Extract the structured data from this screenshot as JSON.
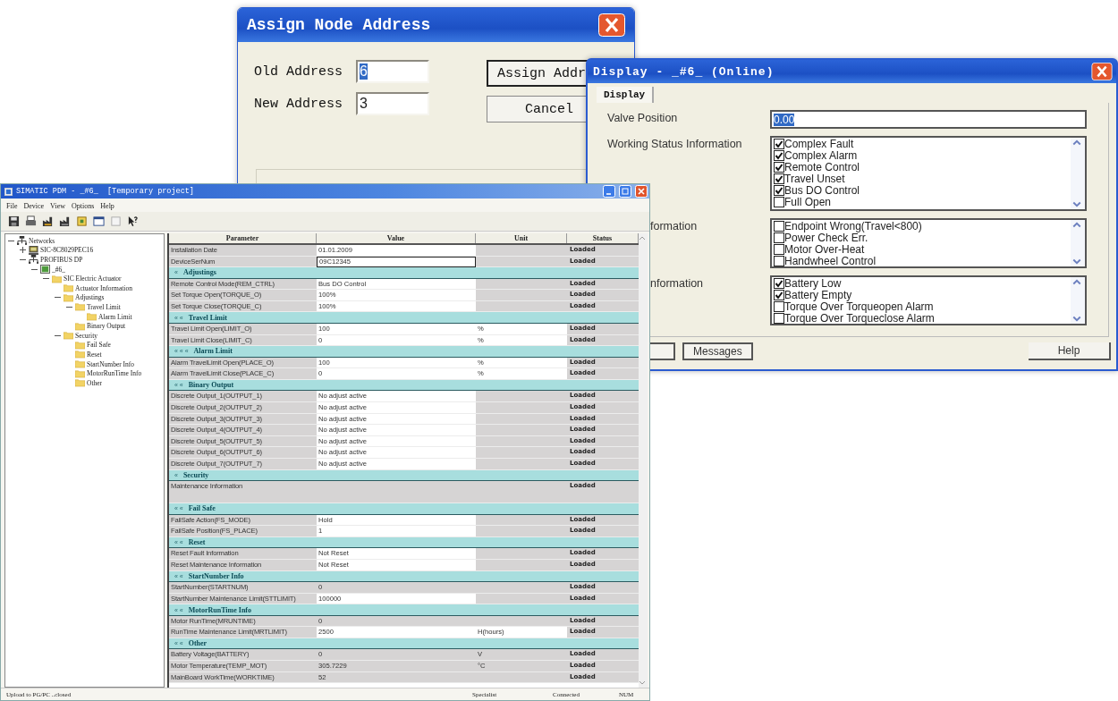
{
  "assign_dialog": {
    "title": "Assign Node Address",
    "fields": [
      {
        "label": "Old Address",
        "value": "6",
        "text_selected": true
      },
      {
        "label": "New Address",
        "value": "3",
        "text_selected": false
      }
    ],
    "buttons": [
      "Assign Addr",
      "Cancel"
    ]
  },
  "display_dialog": {
    "title": "Display - _#6_ (Online)",
    "tabs": [
      {
        "label": "Display",
        "selected": true
      }
    ],
    "valve_position": {
      "label": "Valve Position",
      "value": "0.00",
      "text_selected": true
    },
    "groups": [
      {
        "label": "Working Status Information",
        "items": [
          {
            "label": "Complex Fault",
            "checked": true
          },
          {
            "label": "Complex Alarm",
            "checked": true
          },
          {
            "label": "Remote Control",
            "checked": true
          },
          {
            "label": "Travel Unset",
            "checked": true
          },
          {
            "label": "Bus DO Control",
            "checked": true
          },
          {
            "label": "Full Open",
            "checked": false
          }
        ]
      },
      {
        "label": "formation",
        "items": [
          {
            "label": "Endpoint Wrong(Travel<800)",
            "checked": false
          },
          {
            "label": "Power Check Err.",
            "checked": false
          },
          {
            "label": "Motor Over-Heat",
            "checked": false
          },
          {
            "label": "Handwheel Control",
            "checked": false
          }
        ]
      },
      {
        "label": "nformation",
        "items": [
          {
            "label": "Battery Low",
            "checked": true
          },
          {
            "label": "Battery Empty",
            "checked": true
          },
          {
            "label": "Torque Over Torqueopen Alarm",
            "checked": false
          },
          {
            "label": "Torque Over Torqueclose Alarm",
            "checked": false
          }
        ]
      }
    ],
    "buttons": [
      "Messages",
      "Help"
    ]
  },
  "main_window": {
    "title": "SIMATIC PDM - _#6_  [Temporary project]",
    "menu": [
      "File",
      "Device",
      "View",
      "Options",
      "Help"
    ],
    "tree": [
      {
        "label": "Networks",
        "kind": "network",
        "expanded": true,
        "children": [
          {
            "label": "SIC-8C8029PEC16",
            "kind": "computer",
            "expanded": false
          },
          {
            "label": "PROFIBUS DP",
            "kind": "network",
            "expanded": true,
            "children": [
              {
                "label": "_#6_",
                "kind": "device",
                "expanded": true,
                "children": [
                  {
                    "label": "SIC Electric Actuator",
                    "kind": "folder",
                    "expanded": true,
                    "children": [
                      {
                        "label": "Actuator Information",
                        "kind": "folder"
                      },
                      {
                        "label": "Adjustings",
                        "kind": "folder",
                        "expanded": true,
                        "children": [
                          {
                            "label": "Travel Limit",
                            "kind": "folder",
                            "expanded": true,
                            "children": [
                              {
                                "label": "Alarm Limit",
                                "kind": "folder"
                              }
                            ]
                          },
                          {
                            "label": "Binary Output",
                            "kind": "folder"
                          }
                        ]
                      },
                      {
                        "label": "Security",
                        "kind": "folder",
                        "expanded": true,
                        "children": [
                          {
                            "label": "Fail Safe",
                            "kind": "folder"
                          },
                          {
                            "label": "Reset",
                            "kind": "folder"
                          },
                          {
                            "label": "StartNumber Info",
                            "kind": "folder"
                          },
                          {
                            "label": "MotorRunTime Info",
                            "kind": "folder"
                          },
                          {
                            "label": "Other",
                            "kind": "folder"
                          }
                        ]
                      }
                    ]
                  }
                ]
              }
            ]
          }
        ]
      }
    ],
    "table": {
      "columns": [
        "Parameter",
        "Value",
        "Unit",
        "Status"
      ],
      "rows": [
        {
          "kind": "param",
          "parameter": "Installation Date",
          "value": "01.01.2009",
          "status": "Loaded",
          "editable": true,
          "focused": false
        },
        {
          "kind": "param",
          "parameter": "DeviceSerNum",
          "value": "09C12345",
          "status": "Loaded",
          "editable": true,
          "focused": true
        },
        {
          "kind": "section",
          "marks": "«",
          "label": "Adjustings"
        },
        {
          "kind": "param",
          "parameter": "Remote Control Mode(REM_CTRL)",
          "value": "Bus DO Control",
          "status": "Loaded",
          "editable": true,
          "focused": false
        },
        {
          "kind": "param",
          "parameter": "Set Torque Open(TORQUE_O)",
          "value": "100%",
          "status": "Loaded",
          "editable": true,
          "focused": false
        },
        {
          "kind": "param",
          "parameter": "Set Torque Close(TORQUE_C)",
          "value": "100%",
          "status": "Loaded",
          "editable": true,
          "focused": false
        },
        {
          "kind": "section",
          "marks": "« «",
          "label": "Travel Limit"
        },
        {
          "kind": "param",
          "parameter": "Travel Limit Open(LIMIT_O)",
          "value": "100",
          "unit": "%",
          "status": "Loaded",
          "editable": true,
          "focused": false
        },
        {
          "kind": "param",
          "parameter": "Travel Limit Close(LIMIT_C)",
          "value": "0",
          "unit": "%",
          "status": "Loaded",
          "editable": true,
          "focused": false
        },
        {
          "kind": "section",
          "marks": "« « «",
          "label": "Alarm Limit"
        },
        {
          "kind": "param",
          "parameter": "Alarm TravelLimit Open(PLACE_O)",
          "value": "100",
          "unit": "%",
          "status": "Loaded",
          "editable": true,
          "focused": false
        },
        {
          "kind": "param",
          "parameter": "Alarm TravelLimit Close(PLACE_C)",
          "value": "0",
          "unit": "%",
          "status": "Loaded",
          "editable": true,
          "focused": false
        },
        {
          "kind": "section",
          "marks": "« «",
          "label": "Binary Output"
        },
        {
          "kind": "param",
          "parameter": "Discrete Output_1(OUTPUT_1)",
          "value": "No adjust active",
          "status": "Loaded",
          "editable": true,
          "focused": false
        },
        {
          "kind": "param",
          "parameter": "Discrete Output_2(OUTPUT_2)",
          "value": "No adjust active",
          "status": "Loaded",
          "editable": true,
          "focused": false
        },
        {
          "kind": "param",
          "parameter": "Discrete Output_3(OUTPUT_3)",
          "value": "No adjust active",
          "status": "Loaded",
          "editable": true,
          "focused": false
        },
        {
          "kind": "param",
          "parameter": "Discrete Output_4(OUTPUT_4)",
          "value": "No adjust active",
          "status": "Loaded",
          "editable": true,
          "focused": false
        },
        {
          "kind": "param",
          "parameter": "Discrete Output_5(OUTPUT_5)",
          "value": "No adjust active",
          "status": "Loaded",
          "editable": true,
          "focused": false
        },
        {
          "kind": "param",
          "parameter": "Discrete Output_6(OUTPUT_6)",
          "value": "No adjust active",
          "status": "Loaded",
          "editable": true,
          "focused": false
        },
        {
          "kind": "param",
          "parameter": "Discrete Output_7(OUTPUT_7)",
          "value": "No adjust active",
          "status": "Loaded",
          "editable": true,
          "focused": false
        },
        {
          "kind": "section",
          "marks": "«",
          "label": "Security"
        },
        {
          "kind": "multiline",
          "parameter": "Maintenance Information",
          "status": "Loaded",
          "editable": false,
          "focused": false
        },
        {
          "kind": "section",
          "marks": "« «",
          "label": "Fail Safe"
        },
        {
          "kind": "param",
          "parameter": "FailSafe Action(FS_MODE)",
          "value": "Hold",
          "status": "Loaded",
          "editable": true,
          "focused": false
        },
        {
          "kind": "param",
          "parameter": "FailSafe Position(FS_PLACE)",
          "value": "1",
          "status": "Loaded",
          "editable": true,
          "focused": false
        },
        {
          "kind": "section",
          "marks": "« «",
          "label": "Reset"
        },
        {
          "kind": "param",
          "parameter": "Reset Fault Information",
          "value": "Not Reset",
          "status": "Loaded",
          "editable": true,
          "focused": false
        },
        {
          "kind": "param",
          "parameter": "Reset Maintenance Information",
          "value": "Not Reset",
          "status": "Loaded",
          "editable": true,
          "focused": false
        },
        {
          "kind": "section",
          "marks": "« «",
          "label": "StartNumber Info"
        },
        {
          "kind": "param",
          "parameter": "StartNumber(STARTNUM)",
          "value": "0",
          "status": "Loaded",
          "editable": false,
          "focused": false
        },
        {
          "kind": "param",
          "parameter": "StartNumber Maintenance Limit(STTLIMIT)",
          "value": "100000",
          "status": "Loaded",
          "editable": true,
          "focused": false
        },
        {
          "kind": "section",
          "marks": "« «",
          "label": "MotorRunTime Info"
        },
        {
          "kind": "param",
          "parameter": "Motor RunTime(MRUNTIME)",
          "value": "0",
          "status": "Loaded",
          "editable": false,
          "focused": false
        },
        {
          "kind": "param",
          "parameter": "RunTime Maintenance Limit(MRTLIMIT)",
          "value": "2500",
          "unit": "H(hours)",
          "status": "Loaded",
          "editable": true,
          "focused": false
        },
        {
          "kind": "section",
          "marks": "« «",
          "label": "Other"
        },
        {
          "kind": "param",
          "parameter": "Battery Voltage(BATTERY)",
          "value": "0",
          "unit": "V",
          "status": "Loaded",
          "editable": false,
          "focused": false
        },
        {
          "kind": "param",
          "parameter": "Motor Temperature(TEMP_MOT)",
          "value": "305.7229",
          "unit": "°C",
          "status": "Loaded",
          "editable": false,
          "focused": false
        },
        {
          "kind": "param",
          "parameter": "MainBoard WorkTime(WORKTIME)",
          "value": "52",
          "status": "Loaded",
          "editable": false,
          "focused": false
        }
      ]
    },
    "status_bar": {
      "message": "Upload to PG/PC ..closed",
      "role": "Specialist",
      "connection": "Connected",
      "keyboard": "NUM"
    }
  }
}
